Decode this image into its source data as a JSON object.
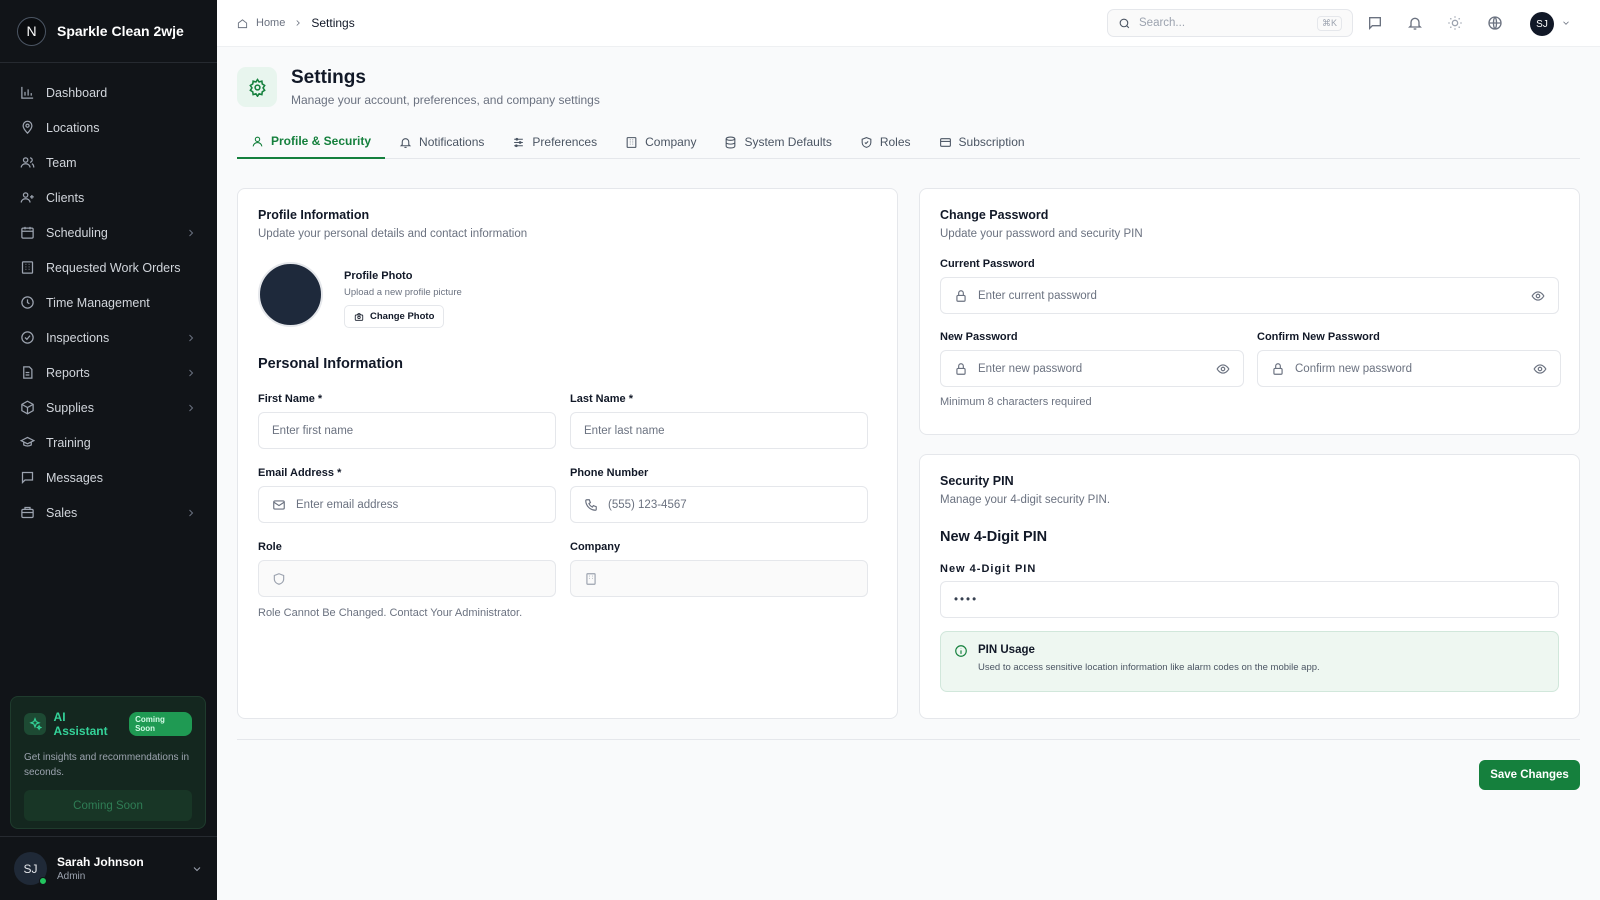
{
  "app": {
    "logo_letter": "N",
    "name": "Sparkle Clean 2wje"
  },
  "sidebar": {
    "items": [
      {
        "label": "Dashboard",
        "icon": "bar-chart-icon"
      },
      {
        "label": "Locations",
        "icon": "map-pin-icon"
      },
      {
        "label": "Team",
        "icon": "users-icon"
      },
      {
        "label": "Clients",
        "icon": "user-plus-icon"
      },
      {
        "label": "Scheduling",
        "icon": "calendar-icon"
      },
      {
        "label": "Requested Work Orders",
        "icon": "building-icon"
      },
      {
        "label": "Time Management",
        "icon": "clock-icon"
      },
      {
        "label": "Inspections",
        "icon": "check-circle-icon"
      },
      {
        "label": "Reports",
        "icon": "file-icon"
      },
      {
        "label": "Supplies",
        "icon": "package-icon"
      },
      {
        "label": "Training",
        "icon": "graduation-cap-icon"
      },
      {
        "label": "Messages",
        "icon": "message-icon"
      },
      {
        "label": "Sales",
        "icon": "briefcase-icon"
      }
    ],
    "ai": {
      "title": "AI Assistant",
      "badge": "Coming Soon",
      "description": "Get insights and recommendations in seconds.",
      "button": "Coming Soon"
    },
    "user": {
      "initials": "SJ",
      "name": "Sarah Johnson",
      "role": "Admin"
    }
  },
  "topbar": {
    "breadcrumb_home": "Home",
    "breadcrumb_current": "Settings",
    "search_placeholder": "Search...",
    "search_shortcut": "⌘K",
    "avatar_initials": "SJ"
  },
  "page": {
    "title": "Settings",
    "subtitle": "Manage your account, preferences, and company settings"
  },
  "tabs": [
    {
      "label": "Profile & Security",
      "icon": "user-icon",
      "active": true
    },
    {
      "label": "Notifications",
      "icon": "bell-icon"
    },
    {
      "label": "Preferences",
      "icon": "sliders-icon"
    },
    {
      "label": "Company",
      "icon": "building-icon"
    },
    {
      "label": "System Defaults",
      "icon": "database-icon"
    },
    {
      "label": "Roles",
      "icon": "shield-icon"
    },
    {
      "label": "Subscription",
      "icon": "credit-card-icon"
    }
  ],
  "profile": {
    "title": "Profile Information",
    "subtitle": "Update your personal details and contact information",
    "photo_label": "Profile Photo",
    "photo_hint": "Upload a new profile picture",
    "change_photo": "Change Photo",
    "personal_title": "Personal Information",
    "first_name_label": "First Name *",
    "first_name_placeholder": "Enter first name",
    "last_name_label": "Last Name *",
    "last_name_placeholder": "Enter last name",
    "email_label": "Email Address *",
    "email_placeholder": "Enter email address",
    "phone_label": "Phone Number",
    "phone_placeholder": "(555) 123-4567",
    "role_label": "Role",
    "company_label": "Company",
    "role_note": "Role Cannot Be Changed. Contact Your Administrator."
  },
  "password": {
    "title": "Change Password",
    "subtitle": "Update your password and security PIN",
    "current_label": "Current Password",
    "current_placeholder": "Enter current password",
    "new_label": "New Password",
    "new_placeholder": "Enter new password",
    "confirm_label": "Confirm New Password",
    "confirm_placeholder": "Confirm new password",
    "hint": "Minimum 8 characters required"
  },
  "pin": {
    "title": "Security PIN",
    "subtitle": "Manage your 4-digit security PIN.",
    "heading": "New 4-Digit PIN",
    "label": "New 4-Digit PIN",
    "value": "••••",
    "usage_title": "PIN Usage",
    "usage_text": "Used to access sensitive location information like alarm codes on the mobile app."
  },
  "actions": {
    "save": "Save Changes"
  },
  "colors": {
    "accent": "#15803d",
    "sidebar_bg": "#111418",
    "ai_badge": "#1f9a53"
  }
}
